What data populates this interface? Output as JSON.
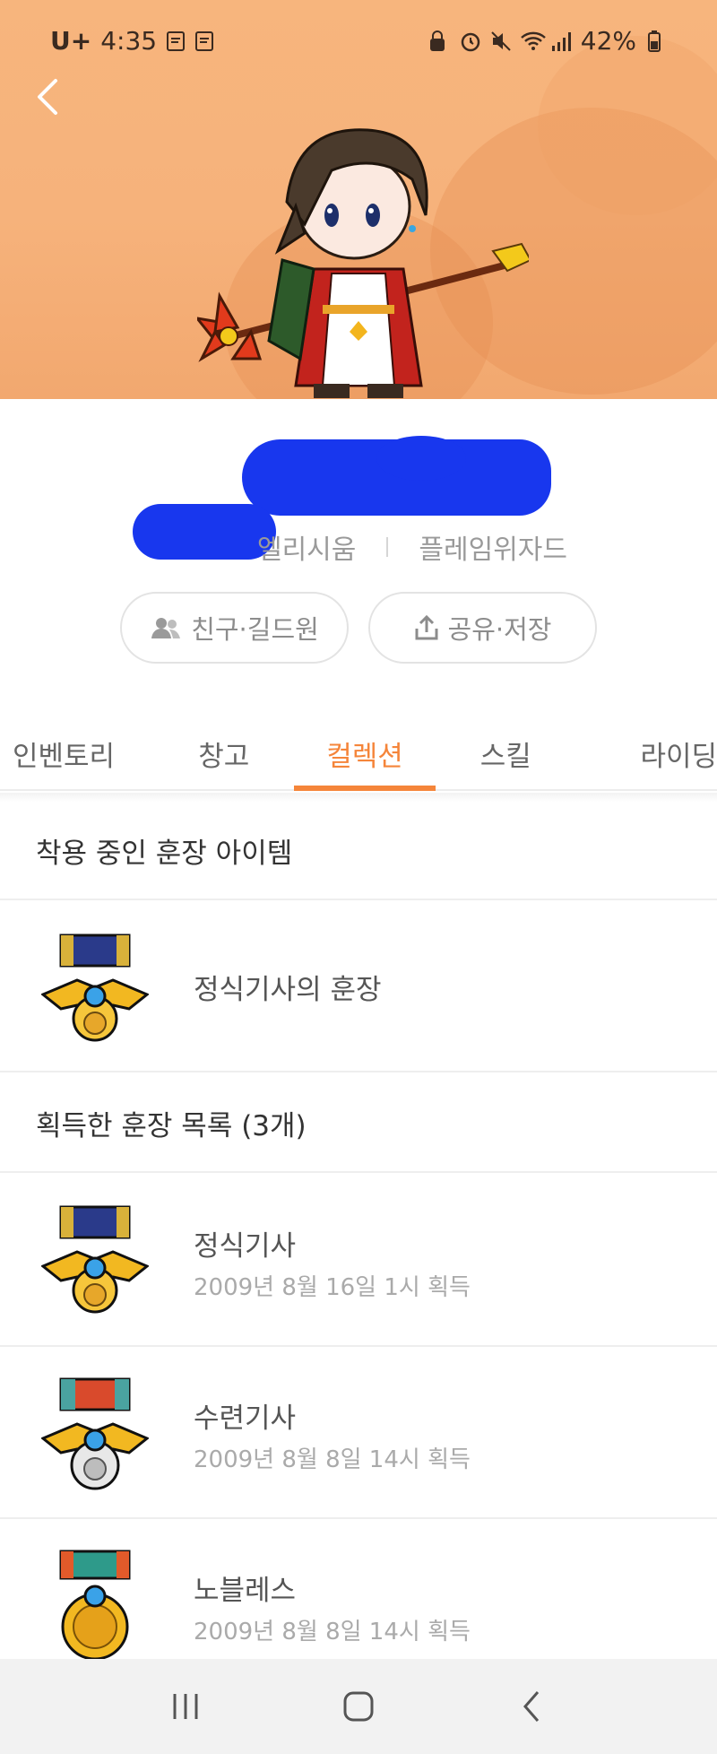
{
  "status_bar": {
    "carrier": "U+",
    "time": "4:35",
    "battery": "42%"
  },
  "profile": {
    "world": "엘리시움",
    "job": "플레임위자드",
    "buttons": {
      "friends": "친구·길드원",
      "share": "공유·저장"
    }
  },
  "tabs": [
    {
      "label": "인벤토리"
    },
    {
      "label": "창고"
    },
    {
      "label": "컬렉션"
    },
    {
      "label": "스킬"
    },
    {
      "label": "라이딩"
    }
  ],
  "active_tab": "컬렉션",
  "equipped_section": {
    "header": "착용 중인 훈장 아이템",
    "item": {
      "name": "정식기사의 훈장"
    }
  },
  "acquired_section": {
    "header": "획득한 훈장 목록 (3개)",
    "items": [
      {
        "name": "정식기사",
        "acquired": "2009년 8월 16일 1시 획득"
      },
      {
        "name": "수련기사",
        "acquired": "2009년 8월 8일 14시 획득"
      },
      {
        "name": "노블레스",
        "acquired": "2009년 8월 8일 14시 획득"
      }
    ]
  },
  "colors": {
    "accent": "#f5853a",
    "hero_bg": "#f7b57d",
    "redaction": "#1837ee"
  }
}
